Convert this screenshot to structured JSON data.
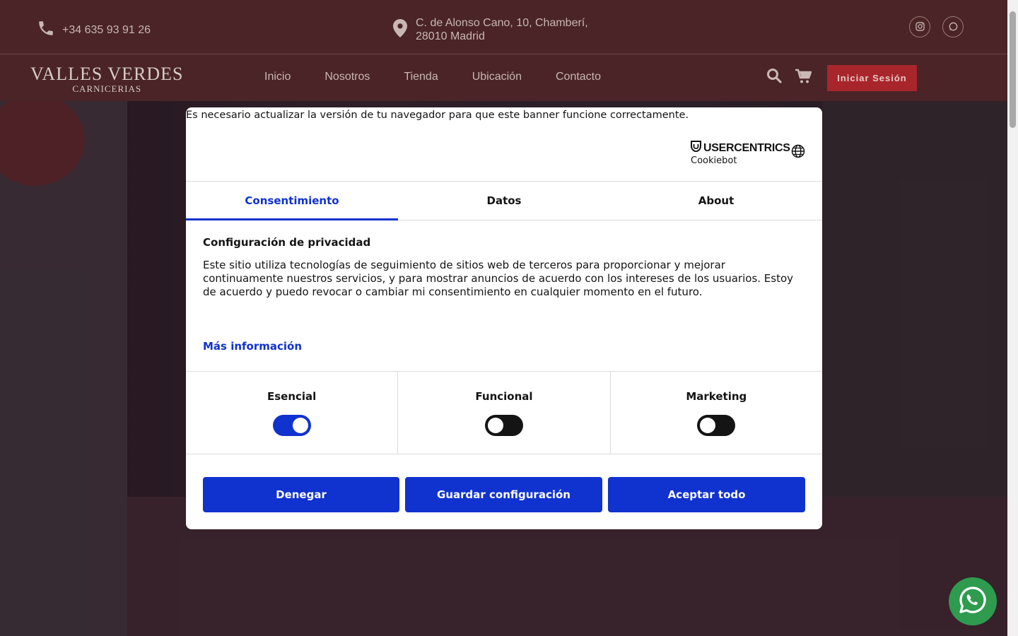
{
  "topbar": {
    "phone": "+34 635 93 91 26",
    "address_line1": "C. de Alonso Cano, 10, Chamberí,",
    "address_line2": "28010 Madrid"
  },
  "logo": {
    "line1": "VALLES VERDES",
    "line2": "CARNICERIAS"
  },
  "nav": {
    "items": [
      "Inicio",
      "Nosotros",
      "Tienda",
      "Ubicación",
      "Contacto"
    ],
    "login": "Iniciar Sesión"
  },
  "dialog": {
    "notice": "Es necesario actualizar la versión de tu navegador para que este banner funcione correctamente.",
    "brand_top": "USERCENTRICS",
    "brand_bottom": "Cookiebot",
    "tabs": [
      "Consentimiento",
      "Datos",
      "About"
    ],
    "title": "Configuración de privacidad",
    "body": "Este sitio utiliza tecnologías de seguimiento de sitios web de terceros para proporcionar y mejorar continuamente nuestros servicios, y para mostrar anuncios de acuerdo con los intereses de los usuarios. Estoy de acuerdo y puedo revocar o cambiar mi consentimiento en cualquier momento en el futuro.",
    "more": "Más información",
    "categories": [
      {
        "label": "Esencial",
        "enabled": true
      },
      {
        "label": "Funcional",
        "enabled": false
      },
      {
        "label": "Marketing",
        "enabled": false
      }
    ],
    "buttons": {
      "deny": "Denegar",
      "save": "Guardar configuración",
      "accept": "Aceptar todo"
    }
  },
  "colors": {
    "header_bg": "#4a2426",
    "login_button": "#a8262b",
    "accent_blue": "#1032cf",
    "whatsapp_green": "#2e9b4f"
  }
}
